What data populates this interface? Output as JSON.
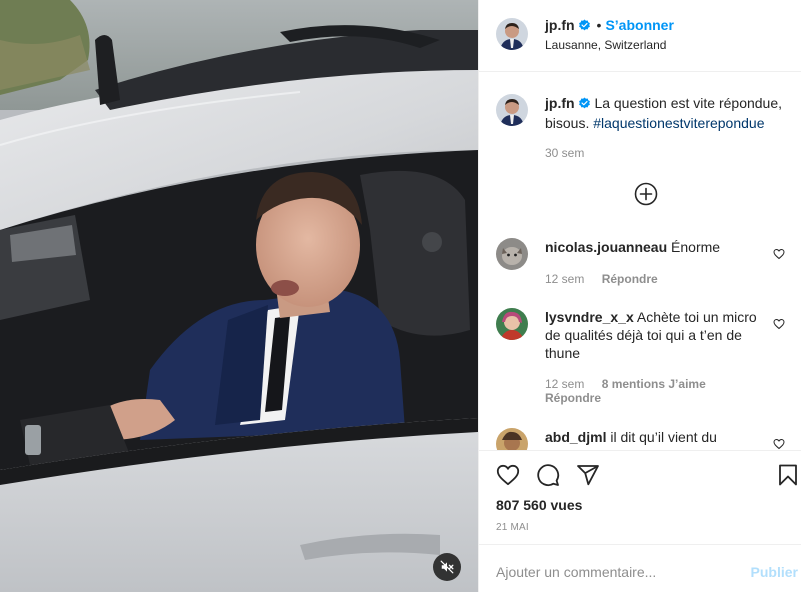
{
  "header": {
    "username": "jp.fn",
    "separator": "•",
    "follow_label": "S’abonner",
    "location": "Lausanne, Switzerland"
  },
  "caption": {
    "username": "jp.fn",
    "text": "La question est vite répondue, bisous.",
    "hashtag": "#laquestionestviterepondue",
    "time": "30 sem"
  },
  "comments": [
    {
      "username": "nicolas.jouanneau",
      "text": "Énorme",
      "time": "12 sem",
      "likes": "",
      "reply": "Répondre"
    },
    {
      "username": "lysvndre_x_x",
      "text": "Achète toi un micro de qualités déjà toi qui a t’en de thune",
      "time": "12 sem",
      "likes": "8 mentions J’aime",
      "reply": "Répondre"
    },
    {
      "username": "abd_djml",
      "text": "il dit qu’il vient du",
      "time": "",
      "likes": "",
      "reply": ""
    }
  ],
  "stats": {
    "views": "807 560 vues",
    "date": "21 mai"
  },
  "add_comment": {
    "placeholder": "Ajouter un commentaire...",
    "publish_label": "Publier"
  },
  "icons": {
    "verified": "verified-badge-icon",
    "load_more": "plus-circle-icon",
    "like": "heart-icon",
    "comment": "comment-bubble-icon",
    "share": "paper-plane-icon",
    "save": "bookmark-icon",
    "mute": "speaker-muted-icon"
  },
  "colors": {
    "accent": "#0095f6",
    "hashtag": "#00376b",
    "secondary_text": "#8e8e8e",
    "publish_disabled": "#b2dffc"
  }
}
